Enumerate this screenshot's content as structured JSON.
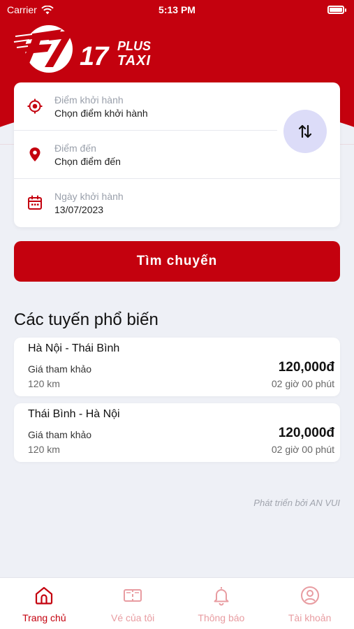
{
  "status_bar": {
    "carrier": "Carrier",
    "time": "5:13 PM"
  },
  "brand": {
    "number": "17",
    "plus": "PLUS",
    "taxi": "TAXI"
  },
  "search": {
    "departure": {
      "label": "Điểm khởi hành",
      "value": "Chọn điểm khởi hành"
    },
    "destination": {
      "label": "Điểm đến",
      "value": "Chọn điểm đến"
    },
    "date": {
      "label": "Ngày khởi hành",
      "value": "13/07/2023"
    },
    "button_label": "Tìm chuyến"
  },
  "popular": {
    "title": "Các tuyến phổ biến",
    "routes": [
      {
        "name": "Hà Nội - Thái Bình",
        "price_label": "Giá tham khảo",
        "price": "120,000đ",
        "distance": "120 km",
        "duration": "02 giờ 00 phút"
      },
      {
        "name": "Thái Bình - Hà Nội",
        "price_label": "Giá tham khảo",
        "price": "120,000đ",
        "distance": "120 km",
        "duration": "02 giờ 00 phút"
      }
    ]
  },
  "credit": "Phát triển bởi AN VUI",
  "tabs": [
    {
      "label": "Trang chủ",
      "icon": "home-icon",
      "active": true
    },
    {
      "label": "Vé của tôi",
      "icon": "ticket-icon",
      "active": false
    },
    {
      "label": "Thông báo",
      "icon": "bell-icon",
      "active": false
    },
    {
      "label": "Tài khoản",
      "icon": "account-icon",
      "active": false
    }
  ],
  "colors": {
    "brand_red": "#c4010e",
    "swap_bg": "#dcdcf8",
    "page_bg": "#eef0f6",
    "inactive_tab": "#e89ca1"
  }
}
